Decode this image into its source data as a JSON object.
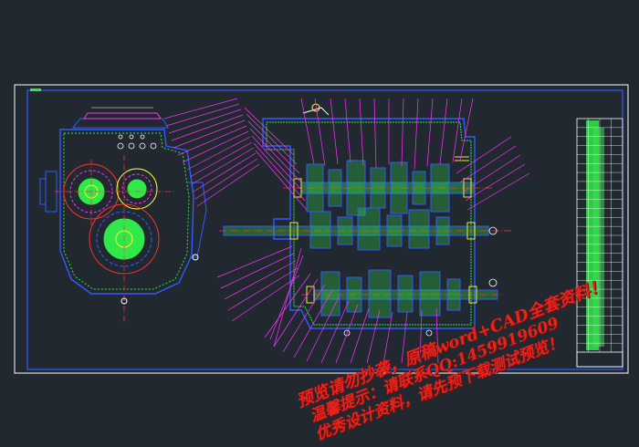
{
  "drawing": {
    "kind": "CAD assembly drawing of a gearbox",
    "colors": {
      "background": "#212830",
      "frame": "#ffffff",
      "outline": "#2f5cff",
      "hatch": "#31e84a",
      "leader": "#ff33ff",
      "accent": "#ffff33",
      "center": "#ff3333"
    }
  },
  "watermark": {
    "line1": "预览请勿抄袭，原稿word+CAD全套资料！",
    "line2": "温馨提示：请联系QQ:1459919609",
    "line3": "优秀设计资料，请先预下载测试预览！"
  },
  "title_block": {
    "columns": 4,
    "rows": 26
  }
}
